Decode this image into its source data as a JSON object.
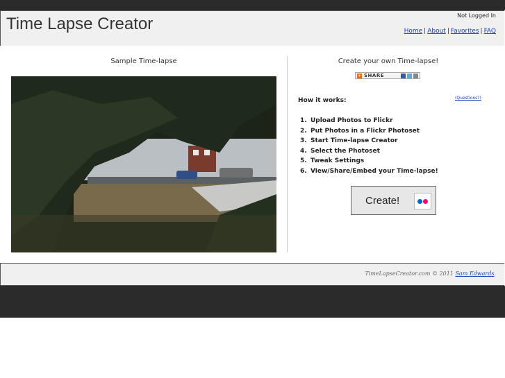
{
  "header": {
    "title": "Time Lapse Creator",
    "login_status": "Not Logged In",
    "nav": [
      "Home",
      "About",
      "Favorites",
      "FAQ"
    ],
    "nav_separator": "|"
  },
  "left": {
    "title": "Sample Time-lapse"
  },
  "right": {
    "title": "Create your own Time-lapse!",
    "share_label": "SHARE",
    "how_title": "How it works:",
    "questions": "(Questions?)",
    "steps": [
      {
        "num": "1.",
        "text": "Upload Photos to Flickr"
      },
      {
        "num": "2.",
        "text": "Put Photos in a Flickr Photoset"
      },
      {
        "num": "3.",
        "text": "Start Time-lapse Creator"
      },
      {
        "num": "4.",
        "text": "Select the Photoset"
      },
      {
        "num": "5.",
        "text": "Tweak Settings"
      },
      {
        "num": "6.",
        "text": "View/Share/Embed your Time-lapse!"
      }
    ],
    "create_label": "Create!"
  },
  "footer": {
    "copyright": "TimeLapseCreator.com © 2011",
    "author": "Sam Edwards",
    "period": "."
  },
  "colors": {
    "link": "#1a3fbf",
    "flickr_blue": "#0063dc",
    "flickr_pink": "#ff0084",
    "bar": "#2b2b2b"
  }
}
